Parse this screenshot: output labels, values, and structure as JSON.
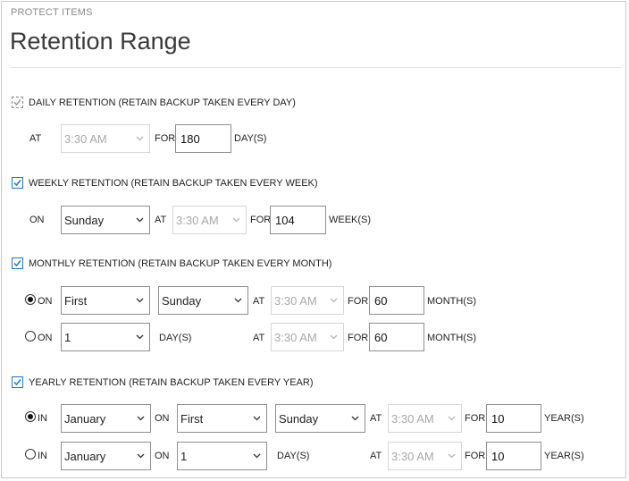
{
  "header": {
    "eyebrow": "PROTECT ITEMS",
    "title": "Retention Range"
  },
  "colors": {
    "accent": "#1b78c8",
    "border": "#8e8e8e",
    "disabled_text": "#a8a8a8"
  },
  "daily": {
    "checked": true,
    "label": "DAILY RETENTION (RETAIN BACKUP TAKEN EVERY DAY)",
    "at_label": "AT",
    "time": "3:30 AM",
    "for_label": "FOR",
    "count": "180",
    "unit": "DAY(S)"
  },
  "weekly": {
    "checked": true,
    "label": "WEEKLY RETENTION (RETAIN BACKUP TAKEN EVERY WEEK)",
    "on_label": "ON",
    "day": "Sunday",
    "at_label": "AT",
    "time": "3:30 AM",
    "for_label": "FOR",
    "count": "104",
    "unit": "WEEK(S)"
  },
  "monthly": {
    "checked": true,
    "label": "MONTHLY RETENTION (RETAIN BACKUP TAKEN EVERY MONTH)",
    "row1": {
      "selected": true,
      "on_label": "ON",
      "ordinal": "First",
      "day": "Sunday",
      "at_label": "AT",
      "time": "3:30 AM",
      "for_label": "FOR",
      "count": "60",
      "unit": "MONTH(S)"
    },
    "row2": {
      "selected": false,
      "on_label": "ON",
      "date": "1",
      "day_label": "DAY(S)",
      "at_label": "AT",
      "time": "3:30 AM",
      "for_label": "FOR",
      "count": "60",
      "unit": "MONTH(S)"
    }
  },
  "yearly": {
    "checked": true,
    "label": "YEARLY RETENTION (RETAIN BACKUP TAKEN EVERY YEAR)",
    "row1": {
      "selected": true,
      "in_label": "IN",
      "month": "January",
      "on_label": "ON",
      "ordinal": "First",
      "day": "Sunday",
      "at_label": "AT",
      "time": "3:30 AM",
      "for_label": "FOR",
      "count": "10",
      "unit": "YEAR(S)"
    },
    "row2": {
      "selected": false,
      "in_label": "IN",
      "month": "January",
      "on_label": "ON",
      "date": "1",
      "day_label": "DAY(S)",
      "at_label": "AT",
      "time": "3:30 AM",
      "for_label": "FOR",
      "count": "10",
      "unit": "YEAR(S)"
    }
  }
}
